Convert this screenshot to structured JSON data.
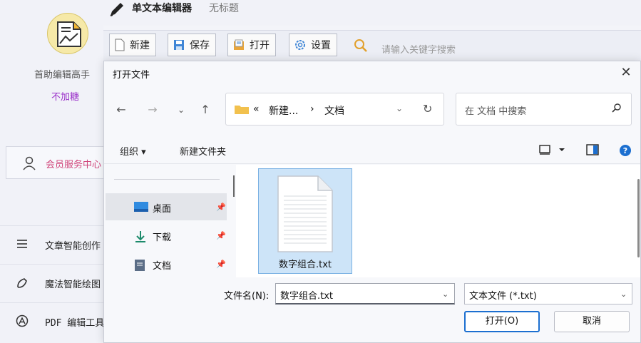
{
  "app": {
    "title": "单文本编辑器",
    "subtitle": "无标题",
    "name": "首助编辑高手",
    "slogan": "不加糖"
  },
  "sidebar": {
    "member_label": "会员服务中心",
    "items": [
      {
        "label": "文章智能创作",
        "icon": "list-icon"
      },
      {
        "label": "魔法智能绘图",
        "icon": "magic-wand-icon"
      },
      {
        "label": "PDF 编辑工具",
        "icon": "pdf-icon"
      }
    ]
  },
  "toolbar": {
    "new_label": "新建",
    "save_label": "保存",
    "open_label": "打开",
    "settings_label": "设置",
    "search_placeholder": "请输入关键字搜索"
  },
  "dialog": {
    "title": "打开文件",
    "close_glyph": "✕",
    "breadcrumb": [
      "«",
      "新建...",
      "›",
      "文档"
    ],
    "search_placeholder": "在 文档 中搜索",
    "organize_label": "组织 ▾",
    "new_folder_label": "新建文件夹",
    "nav_items": [
      {
        "label": "桌面",
        "icon": "desktop-icon",
        "selected": true
      },
      {
        "label": "下载",
        "icon": "download-icon",
        "selected": false
      },
      {
        "label": "文档",
        "icon": "document-icon",
        "selected": false
      }
    ],
    "files": [
      {
        "name": "数字组合.txt",
        "selected": true
      }
    ],
    "filename_label": "文件名(N):",
    "filename_value": "数字组合.txt",
    "filetype_value": "文本文件 (*.txt)",
    "open_button": "打开(O)",
    "cancel_button": "取消"
  },
  "colors": {
    "accent": "#1c6fd0",
    "slogan": "#9a2fc9",
    "member": "#d0457a",
    "selection": "#cde4f8"
  }
}
